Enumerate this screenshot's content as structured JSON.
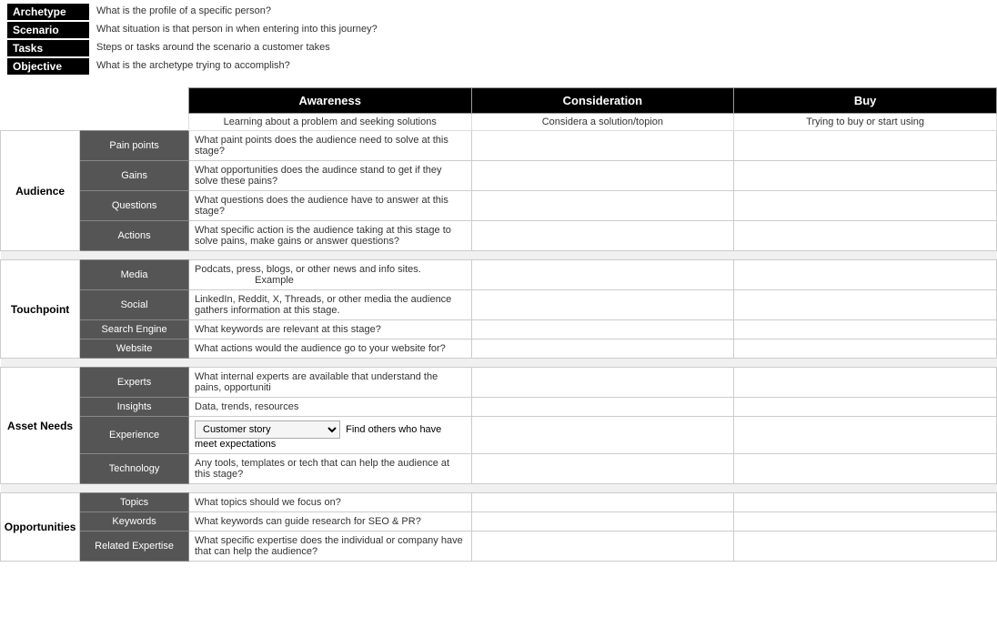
{
  "legend": {
    "items": [
      {
        "label": "Archetype",
        "desc": "What is the profile of a specific person?"
      },
      {
        "label": "Scenario",
        "desc": "What situation is that person in when entering into this journey?"
      },
      {
        "label": "Tasks",
        "desc": "Steps or tasks around the scenario a customer takes"
      },
      {
        "label": "Objective",
        "desc": "What is the archetype trying to accomplish?"
      }
    ]
  },
  "columns": {
    "awareness": {
      "header": "Awareness",
      "sub": "Learning about a problem and seeking solutions"
    },
    "consideration": {
      "header": "Consideration",
      "sub": "Considera a solution/topion"
    },
    "buy": {
      "header": "Buy",
      "sub": "Trying to buy or start using"
    }
  },
  "sections": {
    "audience": {
      "label": "Audience",
      "rows": [
        {
          "sub_label": "Pain points",
          "awareness_text": "What paint points does the audience need to solve at this stage?",
          "consideration_text": "",
          "buy_text": ""
        },
        {
          "sub_label": "Gains",
          "awareness_text": "What opportunities does the audince stand to get if they solve these pains?",
          "consideration_text": "",
          "buy_text": ""
        },
        {
          "sub_label": "Questions",
          "awareness_text": "What questions does the audience have to answer at this stage?",
          "consideration_text": "",
          "buy_text": ""
        },
        {
          "sub_label": "Actions",
          "awareness_text": "What specific action is the audience taking at this stage to solve pains, make gains or answer questions?",
          "consideration_text": "",
          "buy_text": ""
        }
      ]
    },
    "touchpoint": {
      "label": "Touchpoint",
      "rows": [
        {
          "sub_label": "Media",
          "awareness_text": "Podcats, press, blogs, or other news and info sites.",
          "awareness_extra": "Example",
          "consideration_text": "",
          "buy_text": ""
        },
        {
          "sub_label": "Social",
          "awareness_text": "LinkedIn, Reddit, X, Threads, or other media the audience gathers information at this stage.",
          "consideration_text": "",
          "buy_text": ""
        },
        {
          "sub_label": "Search Engine",
          "awareness_text": "What keywords are relevant at this stage?",
          "consideration_text": "",
          "buy_text": ""
        },
        {
          "sub_label": "Website",
          "awareness_text": "What actions would the audience go to your website for?",
          "consideration_text": "",
          "buy_text": ""
        }
      ]
    },
    "asset_needs": {
      "label": "Asset Needs",
      "rows": [
        {
          "sub_label": "Experts",
          "awareness_text": "What internal experts are available that understand the pains, opportuniti",
          "consideration_text": "",
          "buy_text": ""
        },
        {
          "sub_label": "Insights",
          "awareness_text": "Data, trends, resources",
          "consideration_text": "",
          "buy_text": ""
        },
        {
          "sub_label": "Experience",
          "awareness_dropdown": "Customer story",
          "awareness_extra": "Find others who have meet expectations",
          "consideration_text": "",
          "buy_text": ""
        },
        {
          "sub_label": "Technology",
          "awareness_text": "Any tools, templates or tech that can help the audience at this stage?",
          "consideration_text": "",
          "buy_text": ""
        }
      ]
    },
    "opportunities": {
      "label": "Opportunities",
      "rows": [
        {
          "sub_label": "Topics",
          "awareness_text": "What topics should we focus on?",
          "consideration_text": "",
          "buy_text": ""
        },
        {
          "sub_label": "Keywords",
          "awareness_text": "What keywords can guide research for SEO & PR?",
          "consideration_text": "",
          "buy_text": ""
        },
        {
          "sub_label": "Related Expertise",
          "awareness_text": "What specific expertise does the individual or company have that can help the audience?",
          "consideration_text": "",
          "buy_text": ""
        }
      ]
    }
  }
}
